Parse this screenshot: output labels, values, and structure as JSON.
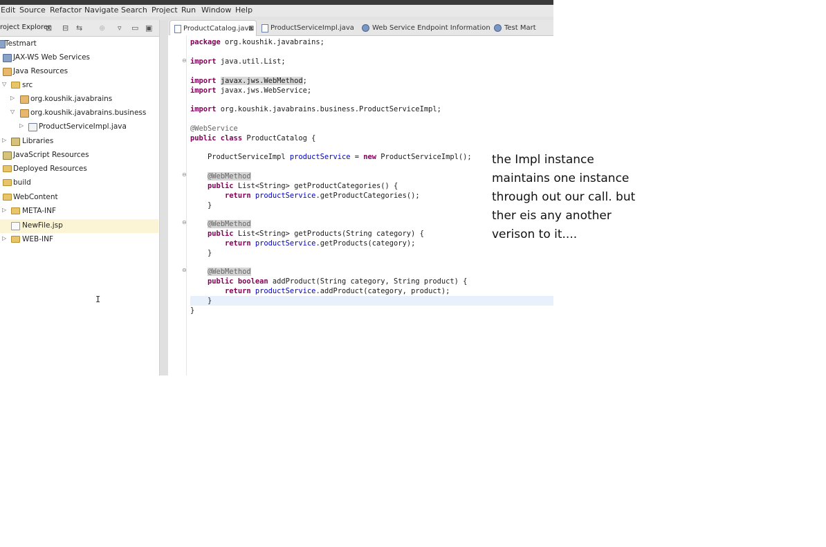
{
  "window": {
    "title": ""
  },
  "menu": [
    "Edit",
    "Source",
    "Refactor",
    "Navigate",
    "Search",
    "Project",
    "Run",
    "Window",
    "Help"
  ],
  "explorer": {
    "title": "roject Explorer",
    "tree": [
      {
        "label": "Testmart",
        "icon": "project-icon",
        "twisty": ""
      },
      {
        "label": "JAX-WS Web Services",
        "icon": "webservice-icon",
        "twisty": ""
      },
      {
        "label": "Java Resources",
        "icon": "java-resources-icon",
        "twisty": ""
      },
      {
        "label": "src",
        "icon": "source-folder-icon",
        "twisty": "expanded"
      },
      {
        "label": "org.koushik.javabrains",
        "icon": "package-icon",
        "twisty": "collapsed"
      },
      {
        "label": "org.koushik.javabrains.business",
        "icon": "package-icon",
        "twisty": "expanded"
      },
      {
        "label": "ProductServiceImpl.java",
        "icon": "java-file-icon",
        "twisty": "collapsed"
      },
      {
        "label": "Libraries",
        "icon": "library-icon",
        "twisty": "collapsed"
      },
      {
        "label": "JavaScript Resources",
        "icon": "library-icon",
        "twisty": ""
      },
      {
        "label": "Deployed Resources",
        "icon": "folder-icon",
        "twisty": ""
      },
      {
        "label": "build",
        "icon": "folder-icon",
        "twisty": ""
      },
      {
        "label": "WebContent",
        "icon": "folder-icon",
        "twisty": ""
      },
      {
        "label": "META-INF",
        "icon": "folder-icon",
        "twisty": "collapsed"
      },
      {
        "label": "NewFile.jsp",
        "icon": "file-icon",
        "twisty": ""
      },
      {
        "label": "WEB-INF",
        "icon": "folder-icon",
        "twisty": "collapsed"
      }
    ]
  },
  "editor": {
    "tabs": [
      {
        "label": "ProductCatalog.java",
        "active": true,
        "icon": "java-file-icon"
      },
      {
        "label": "ProductServiceImpl.java",
        "active": false,
        "icon": "java-file-icon"
      },
      {
        "label": "Web Service Endpoint Information",
        "active": false,
        "icon": "globe-icon"
      },
      {
        "label": "Test Mart",
        "active": false,
        "icon": "globe-icon"
      }
    ],
    "code": {
      "l1_kw": "package",
      "l1_rest": " org.koushik.javabrains;",
      "l2_kw": "import",
      "l2_rest": " java.util.List;",
      "l3_kw": "import",
      "l3_hl": "javax.jws.WebMethod",
      "l3_end": ";",
      "l4_kw": "import",
      "l4_rest": " javax.jws.WebService;",
      "l5_kw": "import",
      "l5_rest": " org.koushik.javabrains.business.ProductServiceImpl;",
      "l6_an": "@WebService",
      "l7_kw": "public class",
      "l7_rest": " ProductCatalog {",
      "l8_pre": "    ProductServiceImpl ",
      "l8_fld": "productService",
      "l8_mid": " = ",
      "l8_kw": "new",
      "l8_end": " ProductServiceImpl();",
      "l9_an": "@WebMethod",
      "l10_kw": "public",
      "l10_rest": " List<String> getProductCategories() {",
      "l11_kw": "return",
      "l11_fld": "productService",
      "l11_end": ".getProductCategories();",
      "close": "}",
      "l12_an": "@WebMethod",
      "l13_kw": "public",
      "l13_rest": " List<String> getProducts(String category) {",
      "l14_kw": "return",
      "l14_fld": "productService",
      "l14_end": ".getProducts(category);",
      "l15_an": "@WebMethod",
      "l16_kw": "public boolean",
      "l16_rest": " addProduct(String category, String product) {",
      "l17_kw": "return",
      "l17_fld": "productService",
      "l17_end": ".addProduct(category, product);"
    }
  },
  "note": {
    "lines": [
      "the Impl instance",
      "maintains one instance",
      "through out our call. but",
      "ther eis any another",
      "verison to it...."
    ]
  }
}
